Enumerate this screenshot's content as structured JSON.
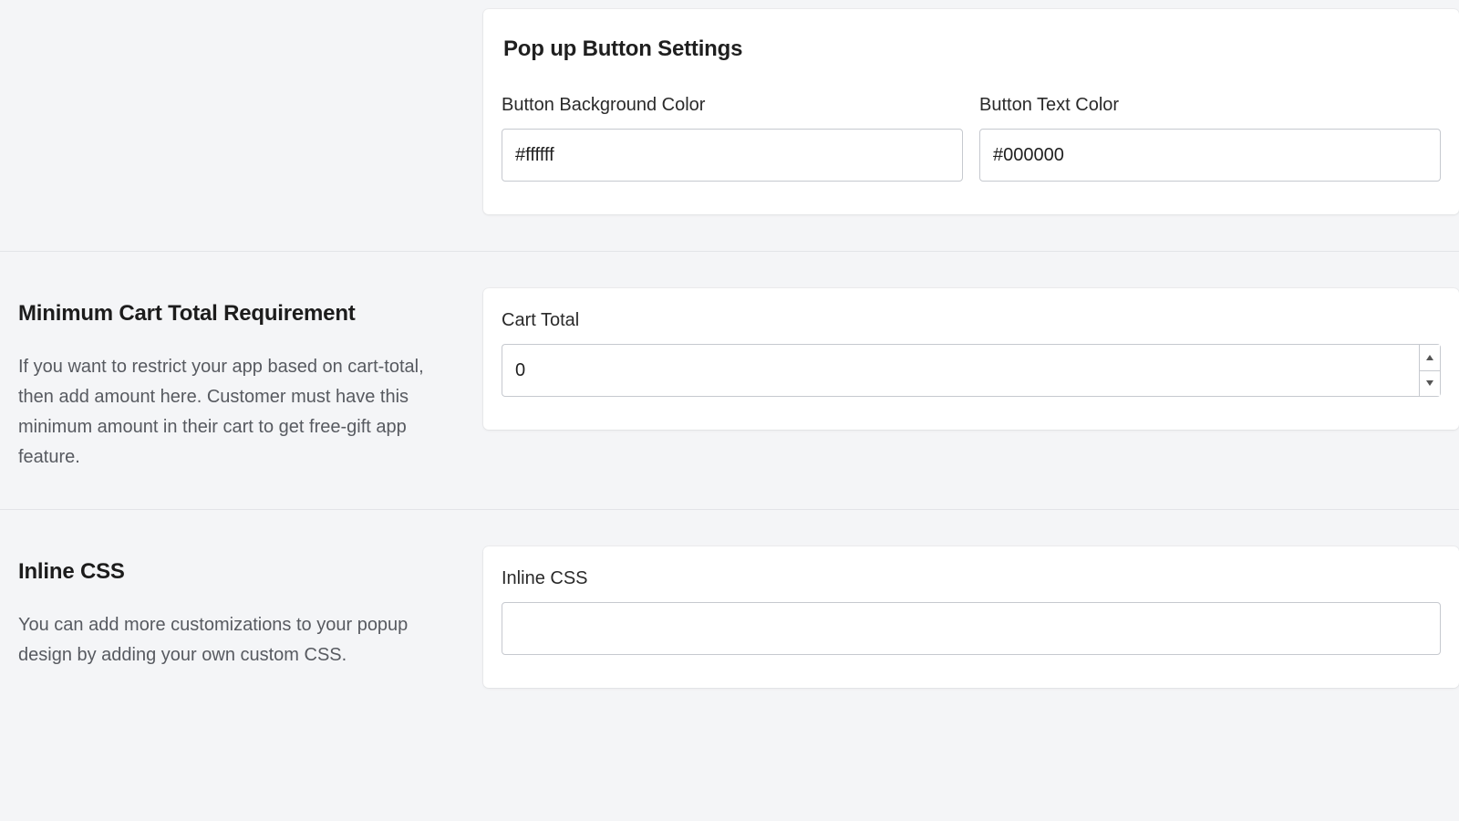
{
  "popup_button": {
    "title": "Pop up Button Settings",
    "bg_label": "Button Background Color",
    "bg_value": "#ffffff",
    "text_label": "Button Text Color",
    "text_value": "#000000"
  },
  "min_cart": {
    "title": "Minimum Cart Total Requirement",
    "description": "If you want to restrict your app based on cart-total, then add amount here. Customer must have this minimum amount in their cart to get free-gift app feature.",
    "field_label": "Cart Total",
    "value": "0"
  },
  "inline_css": {
    "title": "Inline CSS",
    "description": "You can add more customizations to your popup design by adding your own custom CSS.",
    "field_label": "Inline CSS",
    "value": ""
  }
}
